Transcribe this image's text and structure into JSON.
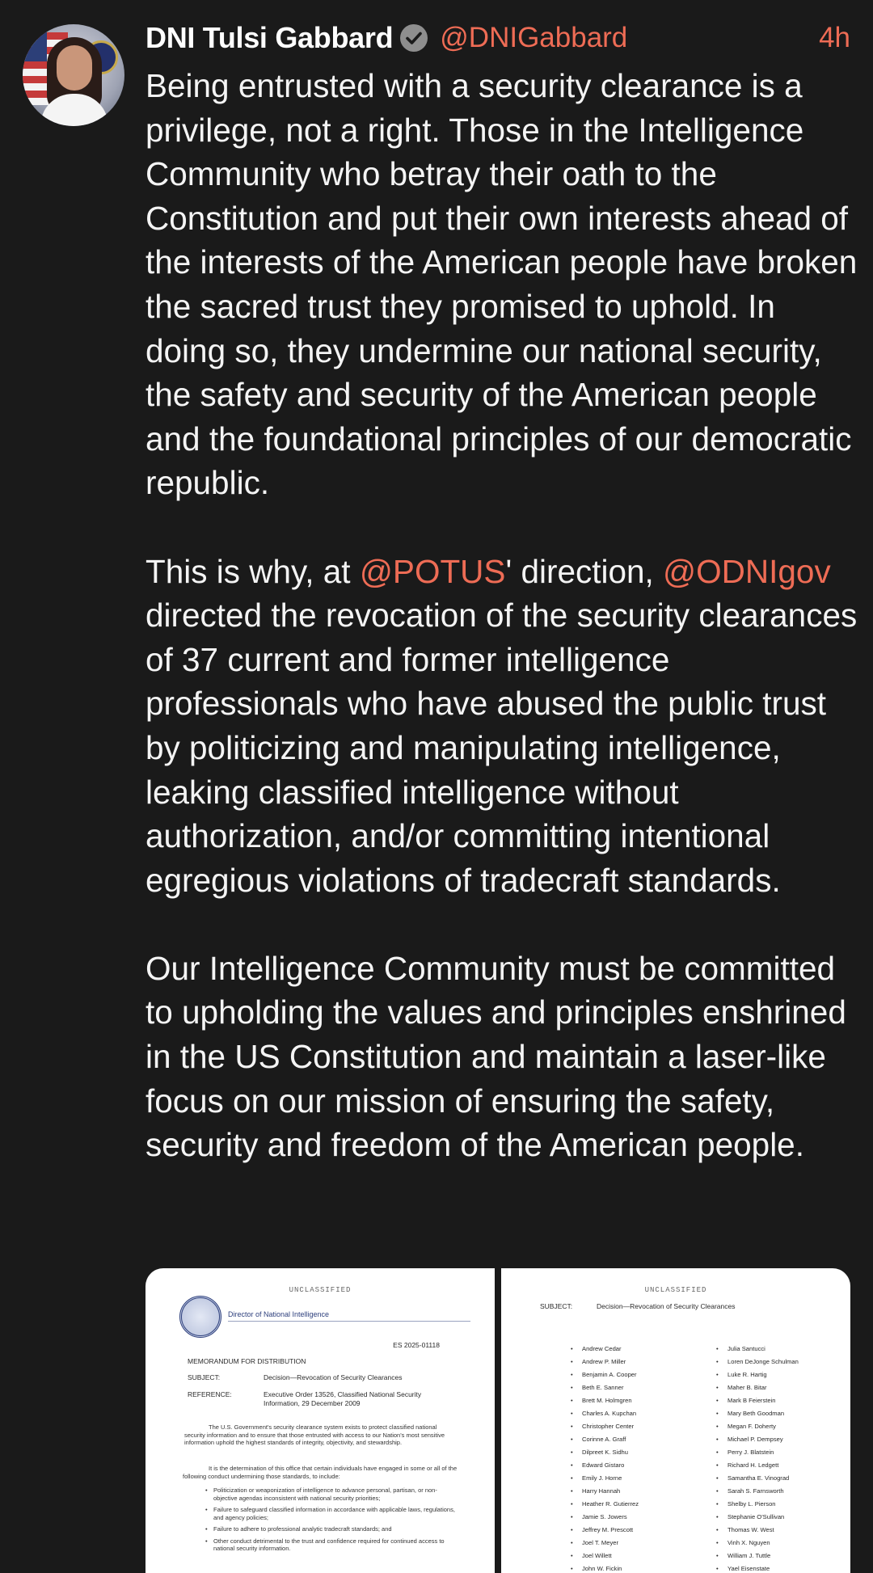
{
  "author": {
    "name": "DNI Tulsi Gabbard",
    "handle": "@DNIGabbard",
    "time": "4h"
  },
  "tweet": {
    "p1": "Being entrusted with a security clearance is a privilege, not a right. Those in the Intelligence Community who betray their oath to the Constitution and put their own interests ahead of the interests of the American people have broken the sacred trust they promised to uphold. In doing so, they undermine our national security, the safety and security of the American people and the foundational principles of our democratic republic.",
    "p2_pre": "This is why, at ",
    "mention_potus": "@POTUS",
    "p2_mid": "' direction, ",
    "mention_odni": "@ODNIgov",
    "p2_post": " directed the revocation of the security clearances of 37 current and former intelligence professionals who have abused the public trust by politicizing and manipulating intelligence, leaking classified intelligence without authorization, and/or committing intentional egregious violations of tradecraft standards.",
    "p3": "Our Intelligence Community must be committed to upholding the values and principles enshrined in the US Constitution and maintain a laser-like focus on our mission of ensuring the safety, security and freedom of the American people."
  },
  "doc1": {
    "classification": "UNCLASSIFIED",
    "office": "Director of National Intelligence",
    "number": "ES 2025-01118",
    "memo": "MEMORANDUM FOR DISTRIBUTION",
    "subject_label": "SUBJECT:",
    "subject": "Decision—Revocation of Security Clearances",
    "reference_label": "REFERENCE:",
    "reference_1": "Executive Order 13526, Classified National Security",
    "reference_2": "Information, 29 December 2009",
    "para1": "The U.S. Government's security clearance system exists to protect classified national security information and to ensure that those entrusted with access to our Nation's most sensitive information uphold the highest standards of integrity, objectivity, and stewardship.",
    "para2": "It is the determination of this office that certain individuals have engaged in some or all of the following conduct undermining those standards, to include:",
    "bullets": [
      "Politicization or weaponization of intelligence to advance personal, partisan, or non-objective agendas inconsistent with national security priorities;",
      "Failure to safeguard classified information in accordance with applicable laws, regulations, and agency policies;",
      "Failure to adhere to professional analytic tradecraft standards; and",
      "Other conduct detrimental to the trust and confidence required for continued access to national security information."
    ]
  },
  "doc2": {
    "classification": "UNCLASSIFIED",
    "subject_label": "SUBJECT:",
    "subject": "Decision—Revocation of Security Clearances",
    "names_left": [
      "Andrew Cedar",
      "Andrew P. Miller",
      "Benjamin A. Cooper",
      "Beth E. Sanner",
      "Brett M. Holmgren",
      "Charles A. Kupchan",
      "Christopher Center",
      "Corinne A. Graff",
      "Dilpreet K. Sidhu",
      "Edward Gistaro",
      "Emily J. Horne",
      "Harry Hannah",
      "Heather R. Gutierrez",
      "Jamie S. Jowers",
      "Jeffrey M. Prescott",
      "Joel T. Meyer",
      "Joel Willett",
      "John W. Fickin"
    ],
    "names_right": [
      "Julia Santucci",
      "Loren DeJonge Schulman",
      "Luke R. Hartig",
      "Maher B. Bitar",
      "Mark B Feierstein",
      "Mary Beth Goodman",
      "Megan F. Doherty",
      "Michael P. Dempsey",
      "Perry J. Blatstein",
      "Richard H. Ledgett",
      "Samantha E. Vinograd",
      "Sarah S. Farnsworth",
      "Shelby L. Pierson",
      "Stephanie O'Sullivan",
      "Thomas W. West",
      "Vinh X. Nguyen",
      "William J. Tuttle",
      "Yael Eisenstate"
    ]
  }
}
